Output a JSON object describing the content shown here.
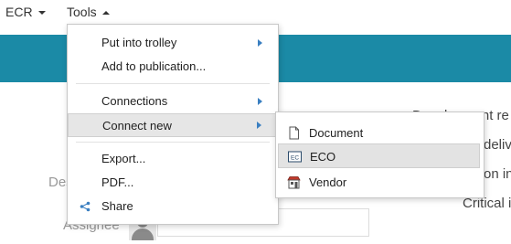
{
  "menubar": {
    "items": [
      {
        "label": "ECR"
      },
      {
        "label": "Tools"
      }
    ]
  },
  "background": {
    "right_fragments": [
      "Development re",
      "delive",
      "on in",
      "Critical i"
    ],
    "description_label": "Des",
    "assignee_label": "Assignee"
  },
  "tools_menu": {
    "items": [
      {
        "label": "Put into trolley",
        "has_submenu": true
      },
      {
        "label": "Add to publication..."
      },
      {
        "label": "Connections",
        "has_submenu": true
      },
      {
        "label": "Connect new",
        "has_submenu": true,
        "active": true
      },
      {
        "label": "Export..."
      },
      {
        "label": "PDF..."
      },
      {
        "label": "Share",
        "icon": "share-icon"
      }
    ]
  },
  "connect_new_submenu": {
    "items": [
      {
        "label": "Document",
        "icon": "document-icon"
      },
      {
        "label": "ECO",
        "icon": "eco-icon",
        "icon_text": "EC",
        "hover": true
      },
      {
        "label": "Vendor",
        "icon": "vendor-icon"
      }
    ]
  },
  "colors": {
    "banner": "#1b8aa6",
    "submenu_arrow": "#3a7fc1"
  }
}
